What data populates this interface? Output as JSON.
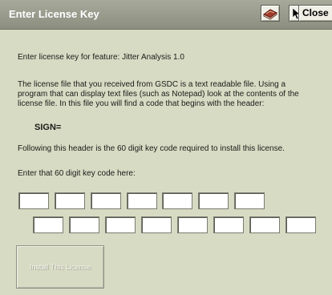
{
  "window": {
    "title": "Enter License Key",
    "close_label": "Close"
  },
  "icons": {
    "book": "book-icon",
    "help": "pointer-help-icon"
  },
  "text": {
    "feature_line": "Enter license key for feature:  Jitter Analysis 1.0",
    "para_line1": "The license file that you received from GSDC is a text readable file.  Using a",
    "para_line2": "program that can display text files (such as Notepad) look at the contents of the",
    "para_line3": "license file.  In this file you will find a code that begins with the header:",
    "header_code": "SIGN=",
    "following_line": "Following this header is the 60 digit key code required to install this license.",
    "enter_line": "Enter that 60 digit key code here:"
  },
  "button": {
    "install_label": "Install This License"
  },
  "colors": {
    "background": "#d8dbc3",
    "titlebar": "#8c8e80"
  }
}
